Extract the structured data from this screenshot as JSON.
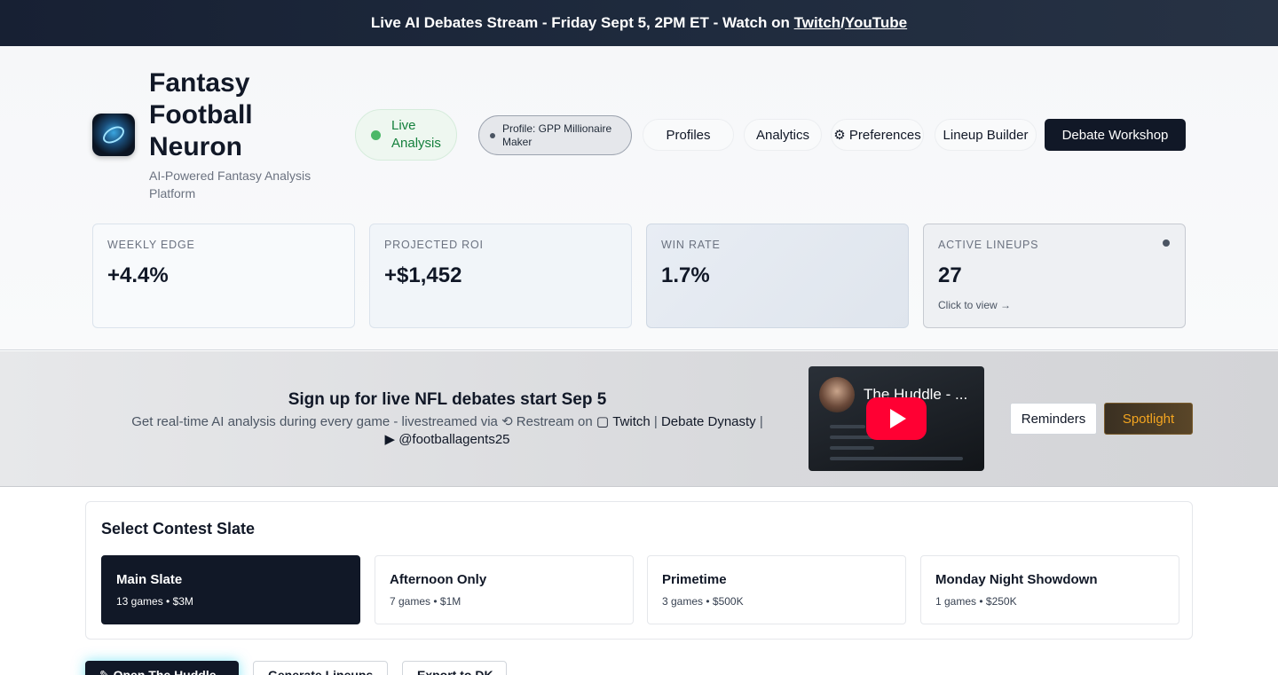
{
  "banner": {
    "text": "Live AI Debates Stream - Friday Sept 5, 2PM ET - Watch on ",
    "link_twitch": "Twitch",
    "separator": "/",
    "link_youtube": "YouTube"
  },
  "brand": {
    "title_lines": [
      "Fantasy",
      "Football",
      "Neuron"
    ],
    "subtitle": "AI-Powered Fantasy Analysis Platform"
  },
  "status": {
    "live_label": "Live Analysis",
    "profile_label": "Profile: GPP Millionaire Maker"
  },
  "nav": {
    "profiles": "Profiles",
    "analytics": "Analytics",
    "preferences": "⚙ Preferences",
    "lineup_builder": "Lineup Builder",
    "debate_workshop": "Debate Workshop"
  },
  "stats": [
    {
      "label": "WEEKLY EDGE",
      "value": "+4.4%"
    },
    {
      "label": "PROJECTED ROI",
      "value": "+$1,452"
    },
    {
      "label": "WIN RATE",
      "value": "1.7%"
    },
    {
      "label": "ACTIVE LINEUPS",
      "value": "27",
      "sub": "Click to view →"
    }
  ],
  "promo": {
    "title": "Sign up for live NFL debates start Sep 5",
    "text_prefix": "Get real-time AI analysis during every game - livestreamed via ",
    "restream": "⟲ Restream on ",
    "twitch": "Twitch",
    "debate_dynasty": "Debate Dynasty",
    "youtube_handle": "@footballagents25",
    "video_title": "The Huddle - ...",
    "reminders": "Reminders",
    "spotlight": "Spotlight"
  },
  "contest": {
    "title": "Select Contest Slate",
    "slates": [
      {
        "name": "Main Slate",
        "meta": "13 games • $3M",
        "active": true
      },
      {
        "name": "Afternoon Only",
        "meta": "7 games • $1M",
        "active": false
      },
      {
        "name": "Primetime",
        "meta": "3 games • $500K",
        "active": false
      },
      {
        "name": "Monday Night Showdown",
        "meta": "1 games • $250K",
        "active": false
      }
    ]
  },
  "bottom_buttons": {
    "huddle": "✎ Open The Huddle",
    "generate": "Generate Lineups",
    "export": "Export to DK"
  },
  "colors": {
    "accent_dark": "#111827",
    "live_green": "#15803d",
    "spotlight_gold": "#f4a520",
    "youtube_red": "#ff0033"
  }
}
